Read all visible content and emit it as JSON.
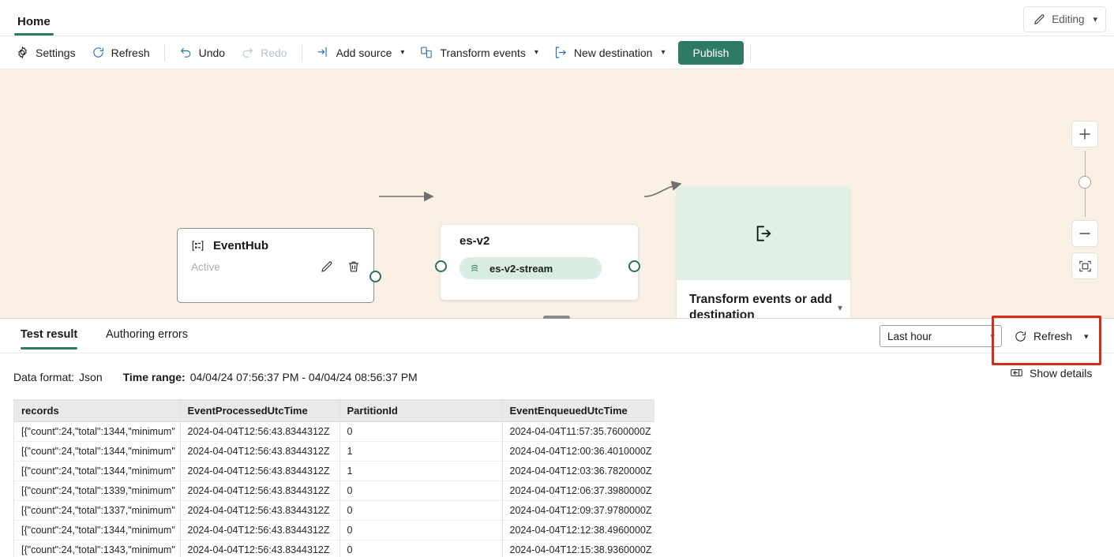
{
  "window": {
    "tab_label": "Home",
    "editing_label": "Editing",
    "editing_icon": "pencil-icon",
    "chevron": "⌄"
  },
  "toolbar": {
    "items": [
      {
        "label": "Settings",
        "icon": "gear-icon",
        "disabled": false,
        "caret": false
      },
      {
        "label": "Refresh",
        "icon": "refresh-icon",
        "disabled": false,
        "caret": false
      },
      {
        "label": "Undo",
        "icon": "undo-icon",
        "disabled": false,
        "caret": false
      },
      {
        "label": "Redo",
        "icon": "redo-icon",
        "disabled": true,
        "caret": false
      },
      {
        "label": "Add source",
        "icon": "add-source-icon",
        "disabled": false,
        "caret": true
      },
      {
        "label": "Transform events",
        "icon": "transform-events-icon",
        "disabled": false,
        "caret": true
      },
      {
        "label": "New destination",
        "icon": "new-destination-icon",
        "disabled": false,
        "caret": true
      }
    ],
    "publish_label": "Publish",
    "publish_color": "#2f7a66"
  },
  "canvas": {
    "background": "#faf1e4",
    "nodes": {
      "eventhub": {
        "title": "EventHub",
        "status": "Active",
        "icon": "eventhub-icon",
        "edit_icon": "pencil-icon",
        "delete_icon": "trash-icon"
      },
      "esv2": {
        "title": "es-v2",
        "stream_label": "es-v2-stream",
        "stream_icon": "eventstream-icon"
      },
      "transform": {
        "icon": "export-icon",
        "label": "Transform events or add destination",
        "chevron": "⌄",
        "header_color": "#dff0e7"
      }
    },
    "zoom_controls": {
      "zoom_in": "+",
      "zoom_out": "−",
      "fit_label": "fit-to-screen-icon"
    }
  },
  "panel": {
    "tabs": [
      {
        "label": "Test result",
        "selected": true
      },
      {
        "label": "Authoring errors",
        "selected": false
      }
    ],
    "time_range_value": "Last hour",
    "refresh_label": "Refresh",
    "refresh_icon": "refresh-icon",
    "show_details_label": "Show details",
    "show_details_icon": "panel-expand-icon",
    "meta": {
      "data_format_key": "Data format:",
      "data_format_value": "Json",
      "time_range_key": "Time range:",
      "time_range_value": "04/04/24 07:56:37 PM - 04/04/24 08:56:37 PM"
    },
    "annotation": {
      "color": "#cf2e1d"
    }
  },
  "table": {
    "columns": [
      "records",
      "EventProcessedUtcTime",
      "PartitionId",
      "EventEnqueuedUtcTime"
    ],
    "rows": [
      [
        "[{\"count\":24,\"total\":1344,\"minimum\"",
        "2024-04-04T12:56:43.8344312Z",
        "0",
        "2024-04-04T11:57:35.7600000Z"
      ],
      [
        "[{\"count\":24,\"total\":1344,\"minimum\"",
        "2024-04-04T12:56:43.8344312Z",
        "1",
        "2024-04-04T12:00:36.4010000Z"
      ],
      [
        "[{\"count\":24,\"total\":1344,\"minimum\"",
        "2024-04-04T12:56:43.8344312Z",
        "1",
        "2024-04-04T12:03:36.7820000Z"
      ],
      [
        "[{\"count\":24,\"total\":1339,\"minimum\"",
        "2024-04-04T12:56:43.8344312Z",
        "0",
        "2024-04-04T12:06:37.3980000Z"
      ],
      [
        "[{\"count\":24,\"total\":1337,\"minimum\"",
        "2024-04-04T12:56:43.8344312Z",
        "0",
        "2024-04-04T12:09:37.9780000Z"
      ],
      [
        "[{\"count\":24,\"total\":1344,\"minimum\"",
        "2024-04-04T12:56:43.8344312Z",
        "0",
        "2024-04-04T12:12:38.4960000Z"
      ],
      [
        "[{\"count\":24,\"total\":1343,\"minimum\"",
        "2024-04-04T12:56:43.8344312Z",
        "0",
        "2024-04-04T12:15:38.9360000Z"
      ]
    ]
  }
}
